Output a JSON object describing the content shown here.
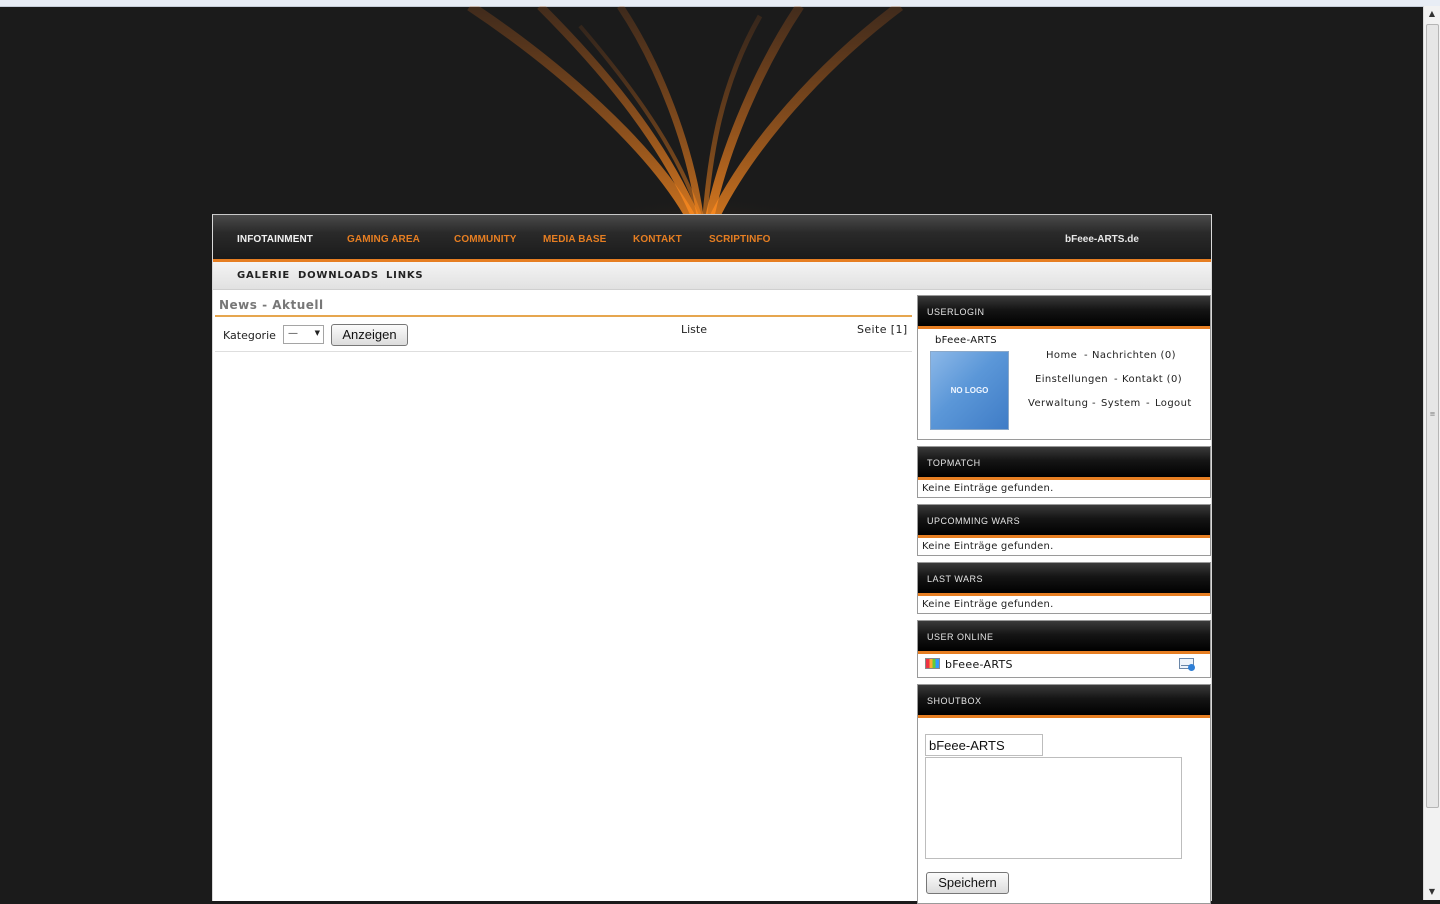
{
  "colors": {
    "accent": "#e67e22",
    "background": "#1b1b1b",
    "content_bg": "#ffffff"
  },
  "header": {
    "nav": [
      {
        "label": "INFOTAINMENT",
        "active": true
      },
      {
        "label": "GAMING AREA"
      },
      {
        "label": "COMMUNITY"
      },
      {
        "label": "MEDIA BASE"
      },
      {
        "label": "KONTAKT"
      },
      {
        "label": "SCRIPTINFO"
      }
    ],
    "site_name": "bFeee-ARTS.de"
  },
  "subnav": [
    "GALERIE",
    "DOWNLOADS",
    "LINKS"
  ],
  "main": {
    "title": "News - Aktuell",
    "filter_label": "Kategorie",
    "filter_value": "—",
    "show_button": "Anzeigen",
    "list_link": "Liste",
    "page_info": "Seite [1]"
  },
  "sidebar": {
    "userlogin": {
      "title": "USERLOGIN",
      "username": "bFeee-ARTS",
      "avatar_text": "NO LOGO",
      "links": {
        "home": "Home",
        "nachrichten": "Nachrichten (0)",
        "einstellungen": "Einstellungen",
        "kontakt": "Kontakt (0)",
        "verwaltung": "Verwaltung",
        "system": "System",
        "logout": "Logout"
      },
      "separator": "-"
    },
    "topmatch": {
      "title": "TOPMATCH",
      "empty": "Keine Einträge gefunden."
    },
    "upcoming": {
      "title": "UPCOMMING WARS",
      "empty": "Keine Einträge gefunden."
    },
    "lastwars": {
      "title": "LAST WARS",
      "empty": "Keine Einträge gefunden."
    },
    "online": {
      "title": "USER ONLINE",
      "user": "bFeee-ARTS"
    },
    "shoutbox": {
      "title": "SHOUTBOX",
      "name_value": "bFeee-ARTS",
      "message_value": "",
      "save_button": "Speichern"
    }
  }
}
